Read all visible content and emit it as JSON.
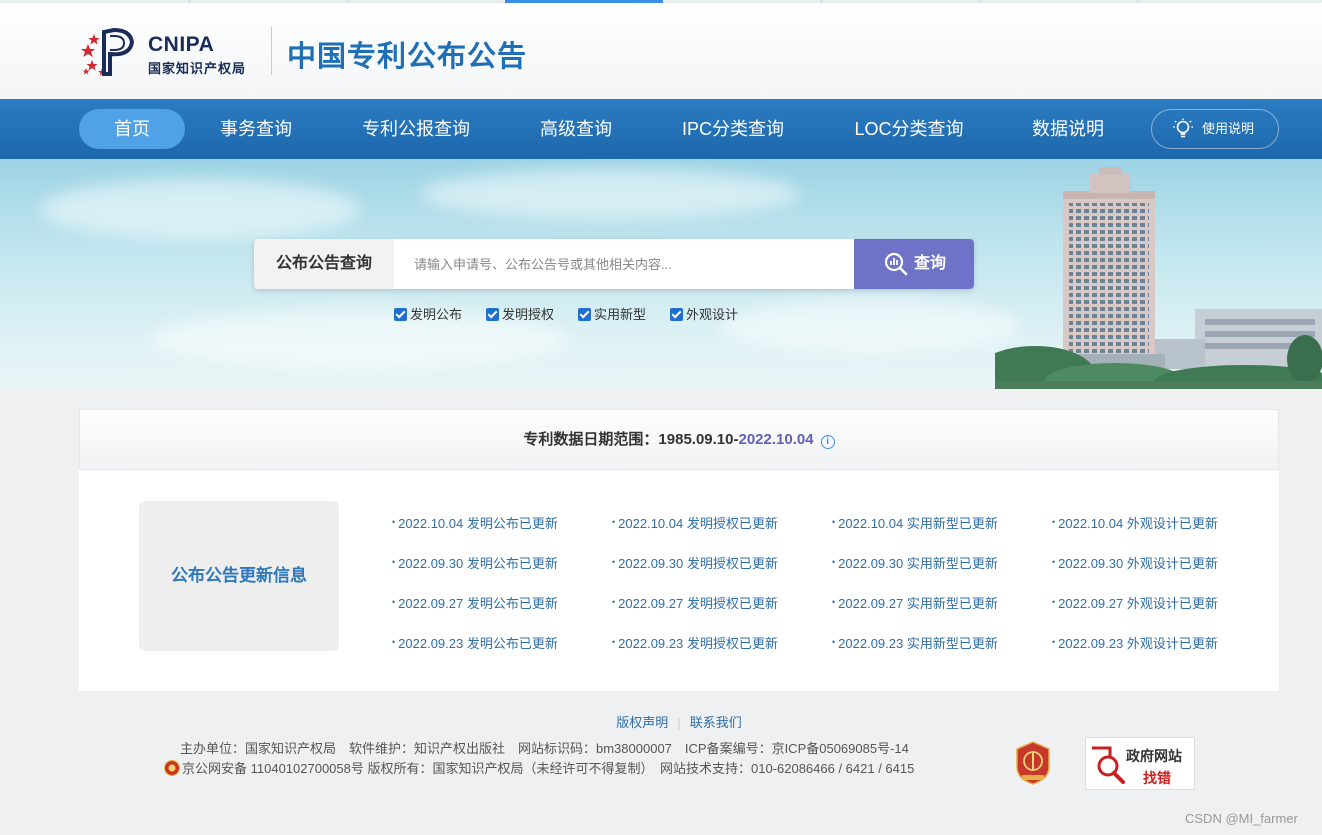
{
  "logo": {
    "en": "CNIPA",
    "cn": "国家知识产权局"
  },
  "site_title": "中国专利公布公告",
  "nav": {
    "items": [
      "首页",
      "事务查询",
      "专利公报查询",
      "高级查询",
      "IPC分类查询",
      "LOC分类查询",
      "数据说明"
    ],
    "active": "首页",
    "help": "使用说明"
  },
  "search": {
    "label": "公布公告查询",
    "placeholder": "请输入申请号、公布公告号或其他相关内容...",
    "value": "",
    "button": "查询",
    "options": [
      {
        "label": "发明公布",
        "checked": true
      },
      {
        "label": "发明授权",
        "checked": true
      },
      {
        "label": "实用新型",
        "checked": true
      },
      {
        "label": "外观设计",
        "checked": true
      }
    ]
  },
  "range": {
    "label": "专利数据日期范围：",
    "start": "1985.09.10-",
    "end": "2022.10.04"
  },
  "updates": {
    "title": "公布公告更新信息",
    "rows": [
      [
        "2022.10.04 发明公布已更新",
        "2022.10.04 发明授权已更新",
        "2022.10.04 实用新型已更新",
        "2022.10.04 外观设计已更新"
      ],
      [
        "2022.09.30 发明公布已更新",
        "2022.09.30 发明授权已更新",
        "2022.09.30 实用新型已更新",
        "2022.09.30 外观设计已更新"
      ],
      [
        "2022.09.27 发明公布已更新",
        "2022.09.27 发明授权已更新",
        "2022.09.27 实用新型已更新",
        "2022.09.27 外观设计已更新"
      ],
      [
        "2022.09.23 发明公布已更新",
        "2022.09.23 发明授权已更新",
        "2022.09.23 实用新型已更新",
        "2022.09.23 外观设计已更新"
      ]
    ]
  },
  "footer": {
    "copyright_link": "版权声明",
    "contact_link": "联系我们",
    "line1": "主办单位：国家知识产权局　软件维护：知识产权出版社　网站标识码：bm38000007　ICP备案编号：京ICP备05069085号-14",
    "line2": "京公网安备 11040102700058号  版权所有：国家知识产权局（未经许可不得复制）　网站技术支持：010-62086466 / 6421 / 6415",
    "gov_title": "政府网站",
    "gov_action": "找错"
  },
  "watermark": "CSDN @MI_farmer",
  "colors": {
    "brand": "#1f6fb5",
    "nav": "#2272b8",
    "accent": "#6f73c7",
    "link": "#2f6ea8"
  }
}
